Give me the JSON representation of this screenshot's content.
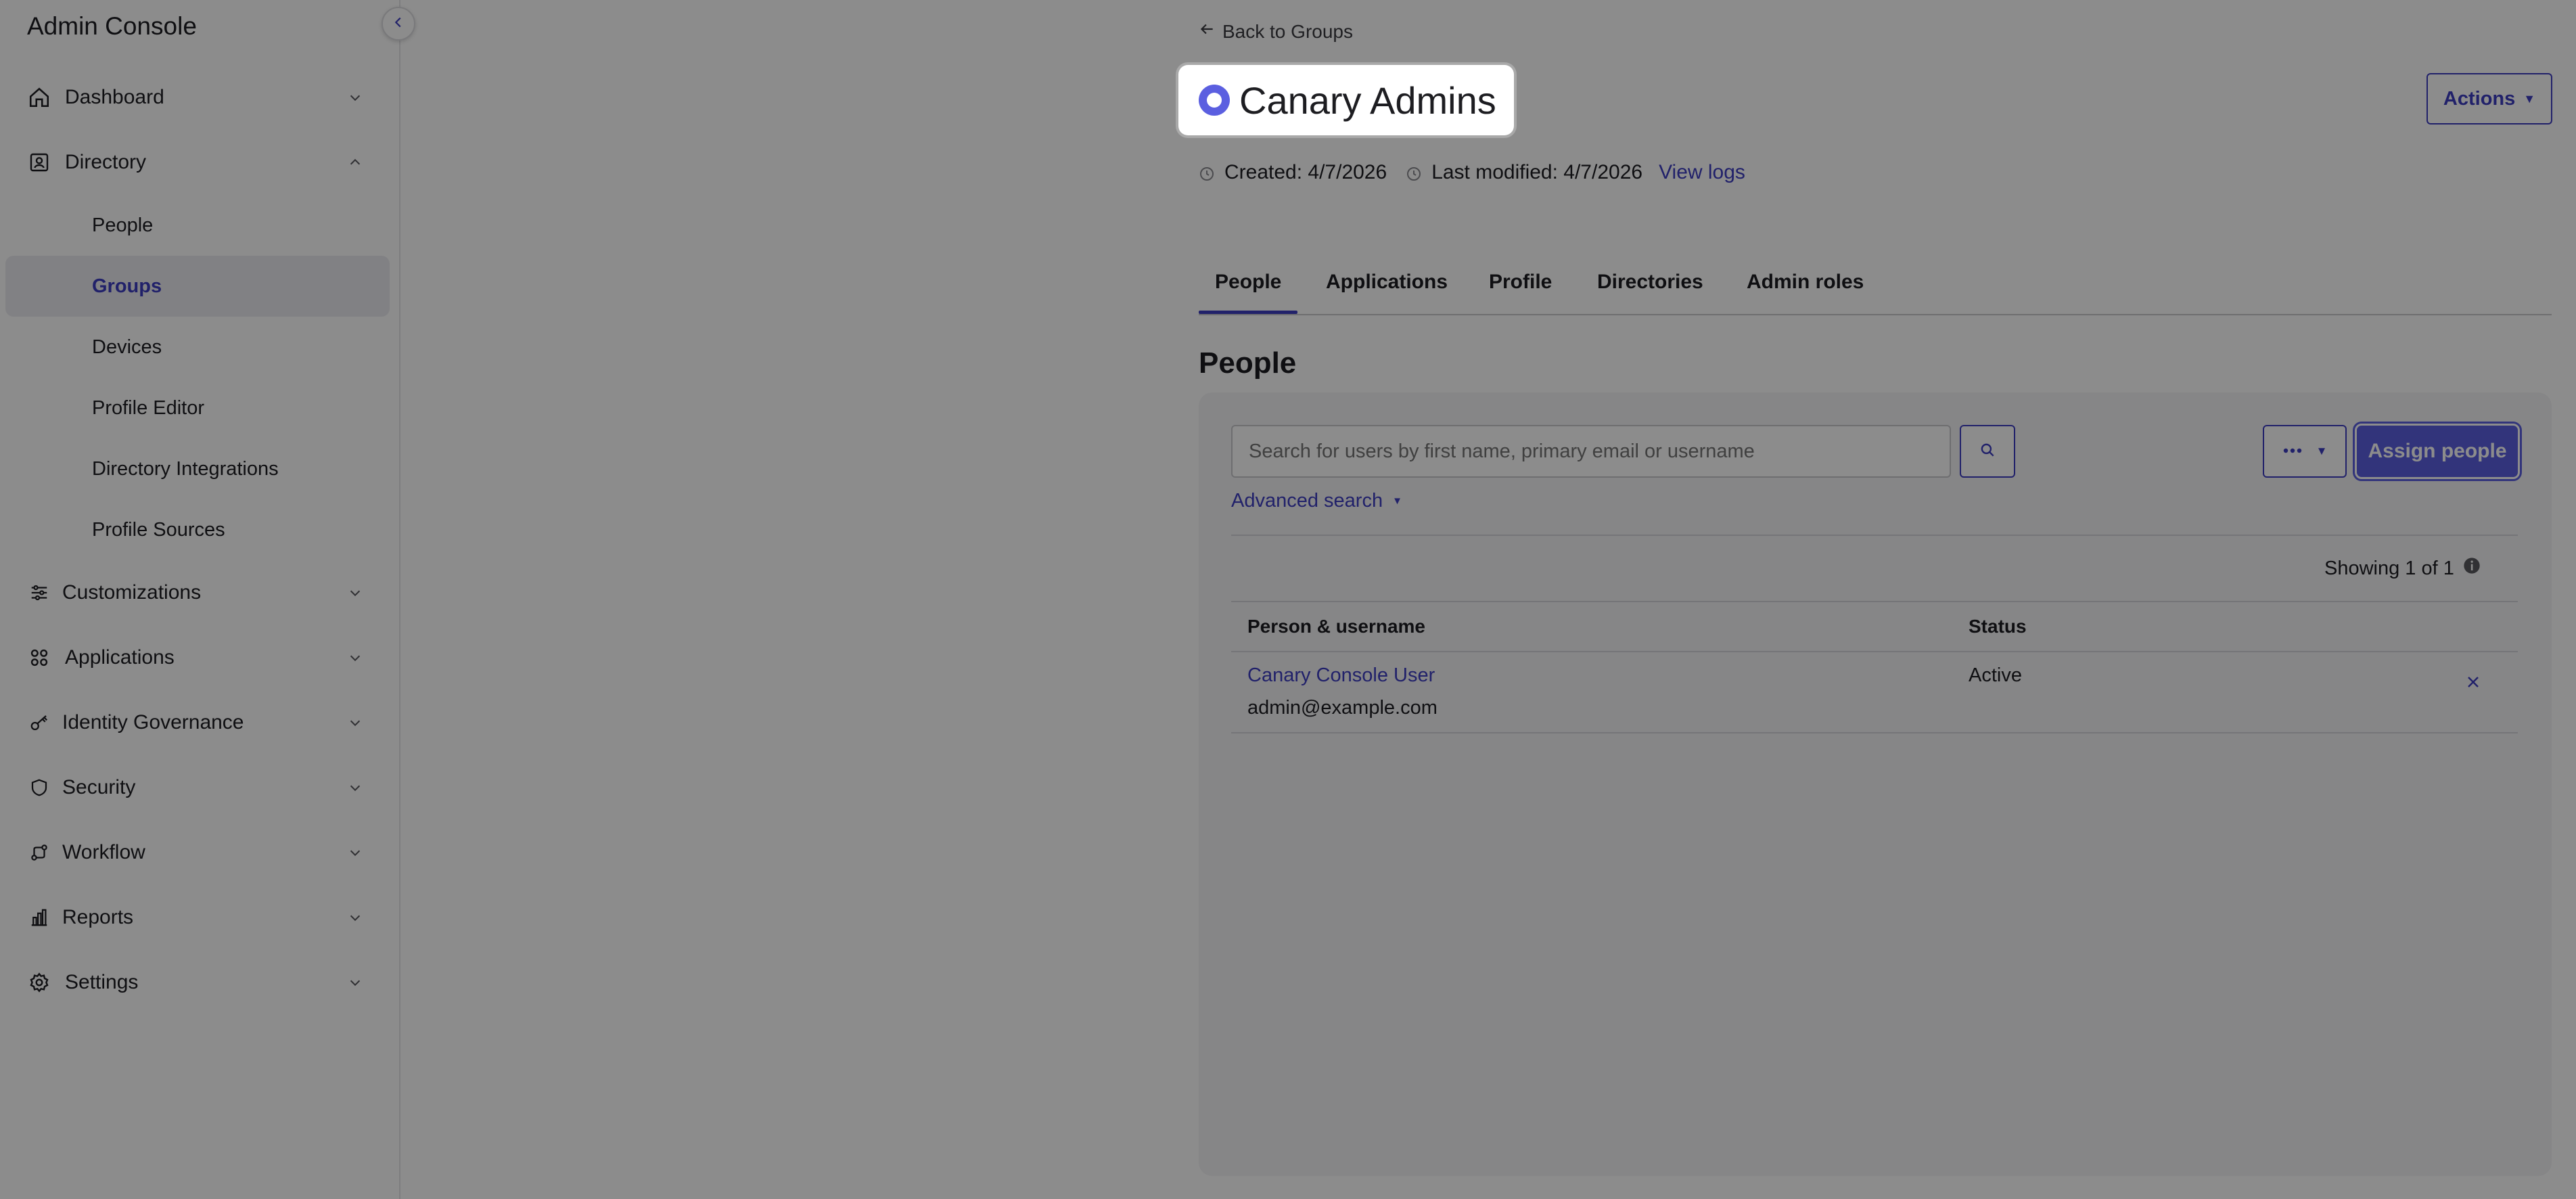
{
  "sidebar": {
    "app_title": "Admin Console",
    "items": [
      {
        "label": "Dashboard",
        "icon": "home-icon"
      },
      {
        "label": "Directory",
        "icon": "directory-icon"
      },
      {
        "label": "Customizations",
        "icon": "sliders-icon"
      },
      {
        "label": "Applications",
        "icon": "apps-grid-icon"
      },
      {
        "label": "Identity Governance",
        "icon": "key-icon"
      },
      {
        "label": "Security",
        "icon": "shield-icon"
      },
      {
        "label": "Workflow",
        "icon": "workflow-icon"
      },
      {
        "label": "Reports",
        "icon": "bar-chart-icon"
      },
      {
        "label": "Settings",
        "icon": "gear-icon"
      }
    ],
    "directory_sub": [
      {
        "label": "People"
      },
      {
        "label": "Groups"
      },
      {
        "label": "Devices"
      },
      {
        "label": "Profile Editor"
      },
      {
        "label": "Directory Integrations"
      },
      {
        "label": "Profile Sources"
      }
    ],
    "selected": "Groups"
  },
  "header": {
    "back_label": "Back to Groups",
    "group_name": "Canary Admins",
    "actions_label": "Actions",
    "created": "Created: 4/7/2026",
    "modified": "Last modified: 4/7/2026",
    "view_logs": "View logs"
  },
  "tabs": [
    {
      "label": "People",
      "active": true
    },
    {
      "label": "Applications"
    },
    {
      "label": "Profile"
    },
    {
      "label": "Directories"
    },
    {
      "label": "Admin roles"
    }
  ],
  "people": {
    "section_title": "People",
    "search_placeholder": "Search for users by first name, primary email or username",
    "advanced_search": "Advanced search",
    "assign_label": "Assign people",
    "showing": "Showing 1 of 1",
    "columns": [
      "Person & username",
      "Status"
    ],
    "rows": [
      {
        "name": "Canary Console User",
        "username": "admin@example.com",
        "status": "Active"
      }
    ]
  },
  "colors": {
    "accent": "#3d3dc2",
    "primary_button": "#5b5fe0",
    "overlay": "rgba(0,0,0,0.45)"
  }
}
